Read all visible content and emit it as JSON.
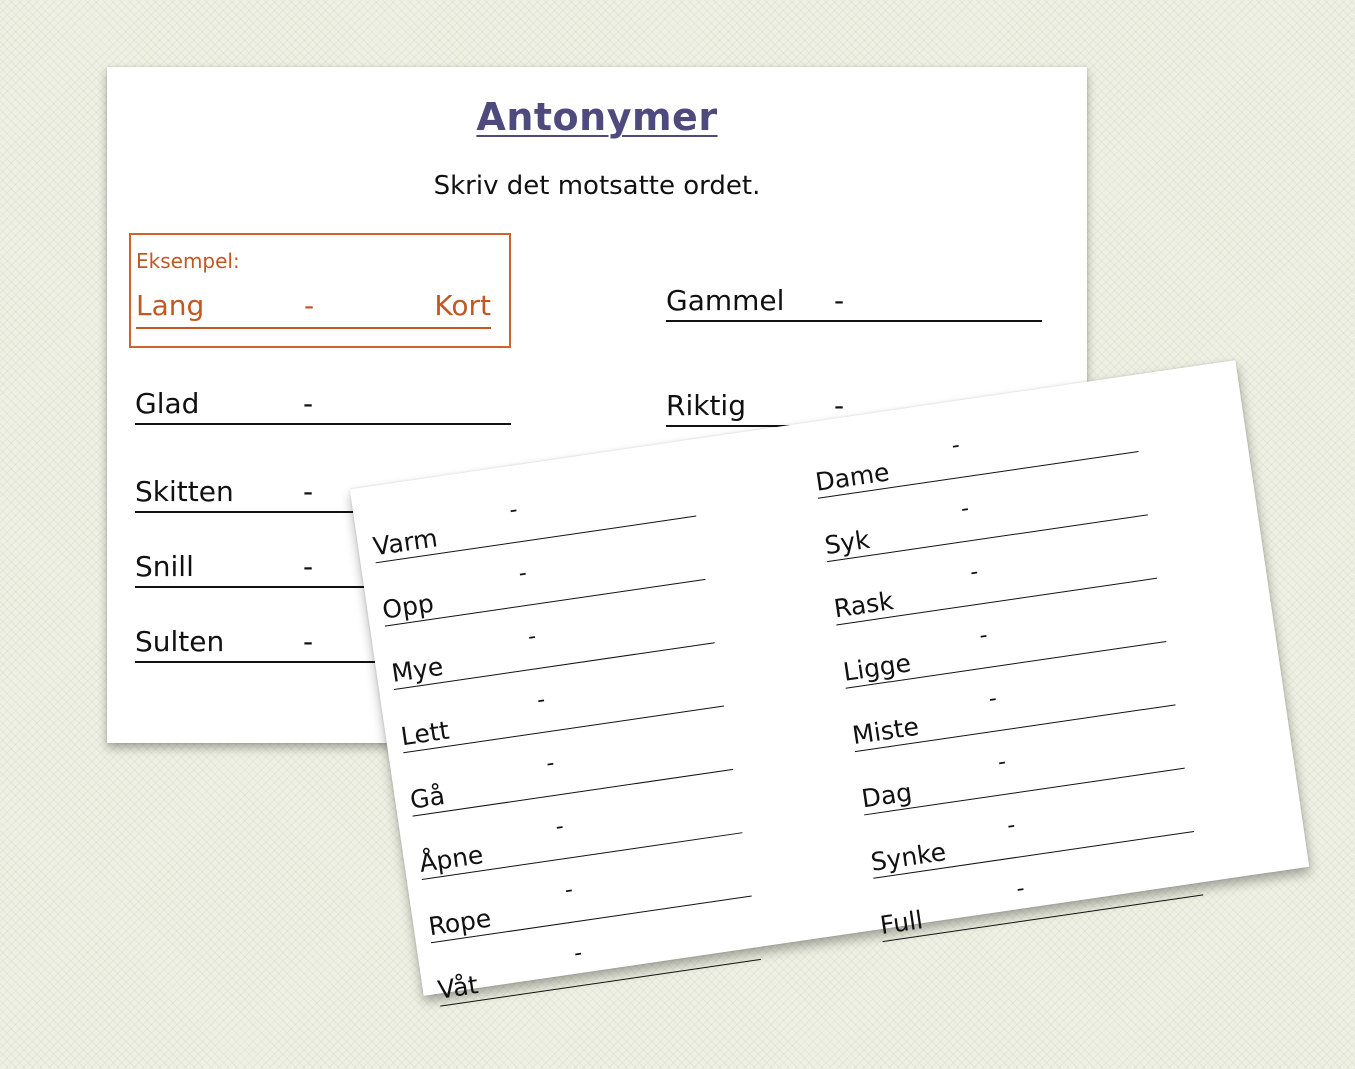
{
  "worksheet_back": {
    "title": "Antonymer",
    "instruction": "Skriv det motsatte ordet.",
    "example": {
      "label": "Eksempel:",
      "word": "Lang",
      "dash": "-",
      "answer": "Kort"
    },
    "left_column": [
      {
        "word": "Glad",
        "dash": "-"
      },
      {
        "word": "Skitten",
        "dash": "-"
      },
      {
        "word": "Snill",
        "dash": "-"
      },
      {
        "word": "Sulten",
        "dash": "-"
      }
    ],
    "right_column": [
      {
        "word": "Gammel",
        "dash": "-"
      },
      {
        "word": "Riktig",
        "dash": "-"
      }
    ]
  },
  "worksheet_front": {
    "left_column": [
      {
        "word": "Varm",
        "dash": "-"
      },
      {
        "word": "Opp",
        "dash": "-"
      },
      {
        "word": "Mye",
        "dash": "-"
      },
      {
        "word": "Lett",
        "dash": "-"
      },
      {
        "word": "Gå",
        "dash": "-"
      },
      {
        "word": "Åpne",
        "dash": "-"
      },
      {
        "word": "Rope",
        "dash": "-"
      },
      {
        "word": "Våt",
        "dash": "-"
      }
    ],
    "right_column": [
      {
        "word": "Dame",
        "dash": "-"
      },
      {
        "word": "Syk",
        "dash": "-"
      },
      {
        "word": "Rask",
        "dash": "-"
      },
      {
        "word": "Ligge",
        "dash": "-"
      },
      {
        "word": "Miste",
        "dash": "-"
      },
      {
        "word": "Dag",
        "dash": "-"
      },
      {
        "word": "Synke",
        "dash": "-"
      },
      {
        "word": "Full",
        "dash": "-"
      }
    ]
  }
}
